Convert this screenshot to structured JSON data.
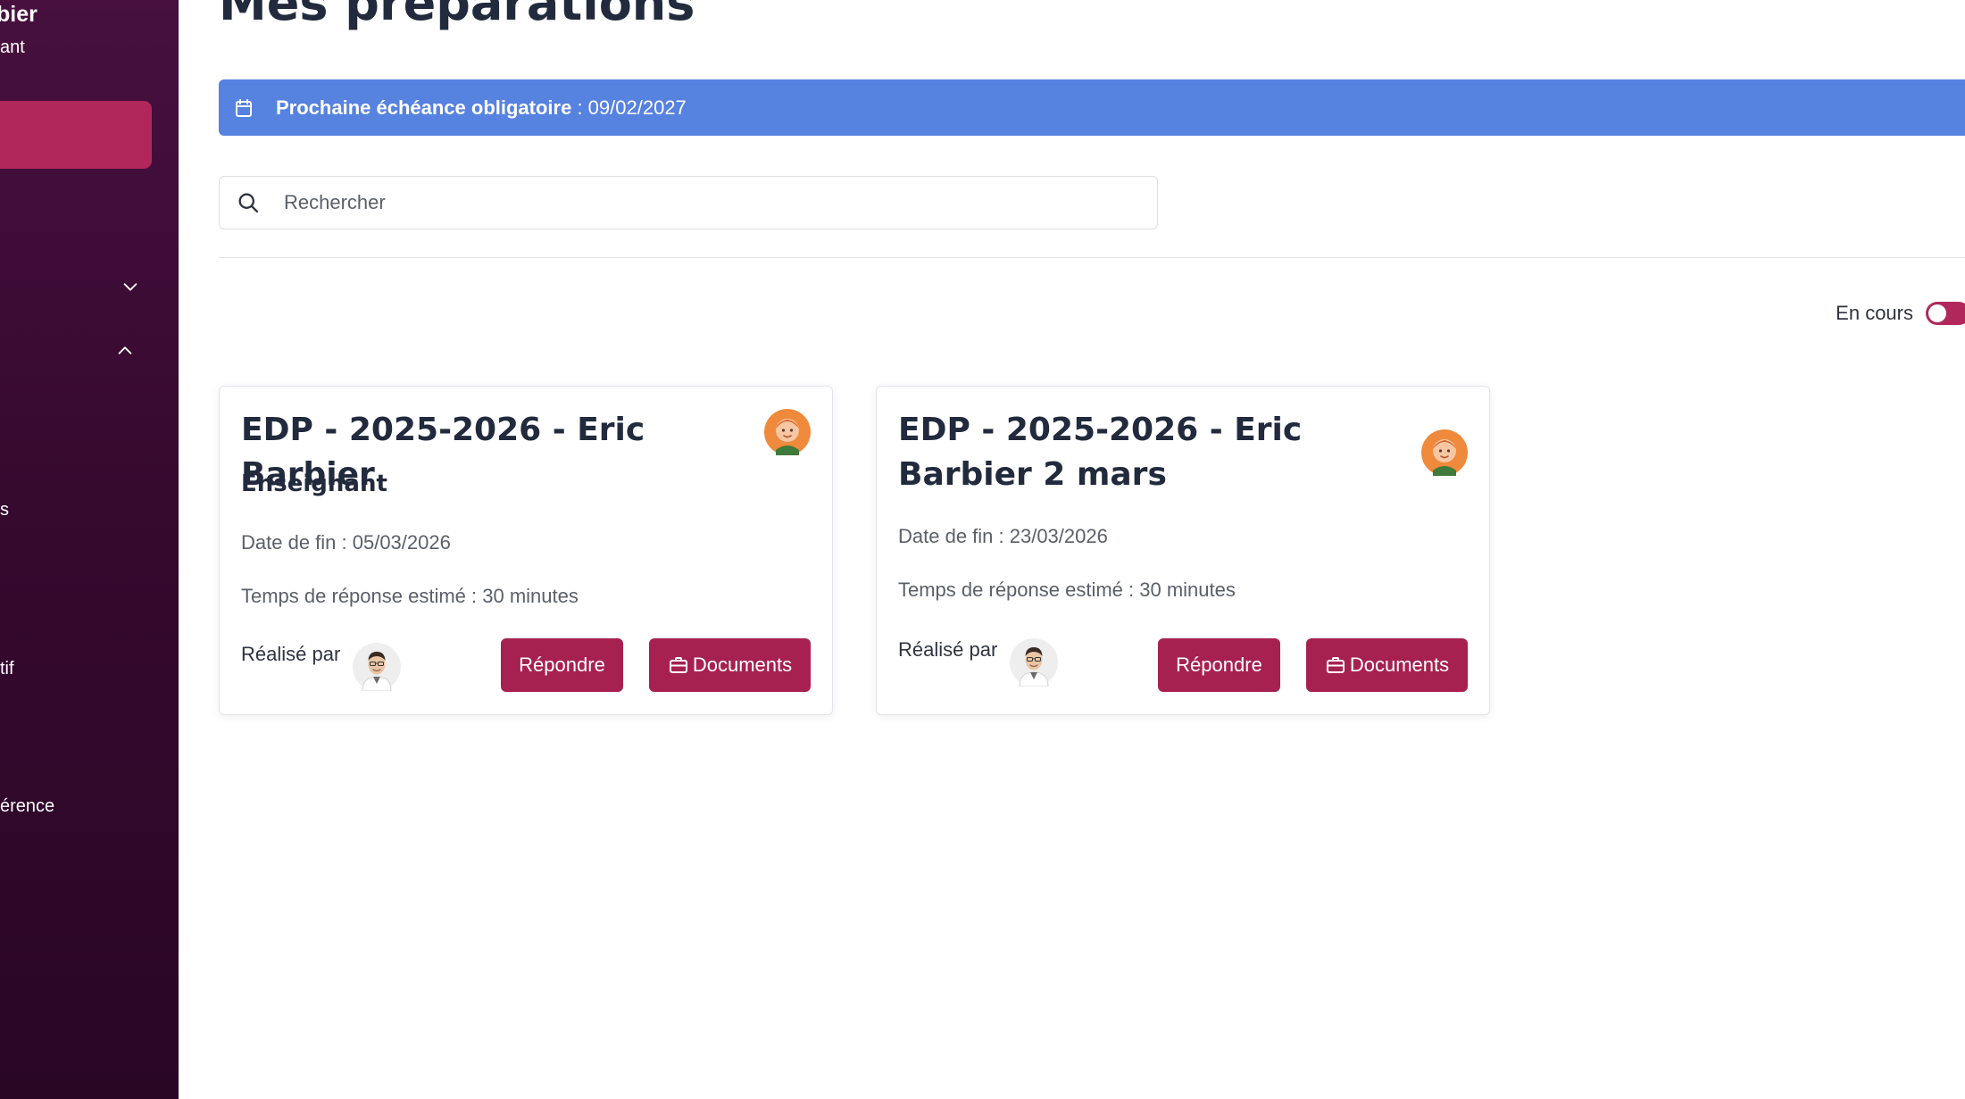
{
  "sidebar": {
    "user_name": "bier",
    "user_role": "ant",
    "items": [
      {
        "label": "s"
      },
      {
        "label": "tif"
      },
      {
        "label": "érence"
      }
    ],
    "icons": [
      "chevron-down-icon",
      "chevron-up-icon"
    ]
  },
  "page": {
    "title": "Mes préparations"
  },
  "banner": {
    "label": "Prochaine échéance obligatoire",
    "value": " : 09/02/2027",
    "icon": "calendar-icon",
    "color": "#5682e0"
  },
  "search": {
    "placeholder": "Rechercher",
    "value": "",
    "icon": "search-icon"
  },
  "filter": {
    "label": "En cours",
    "enabled": true,
    "color": "#b1275c"
  },
  "cards": [
    {
      "title": "EDP - 2025-2026 - Eric Barbier",
      "subtitle": "Enseignant",
      "end_date": "Date de fin : 05/03/2026",
      "estimated_time": "Temps de réponse estimé : 30 minutes",
      "done_by_label": "Réalisé par",
      "respond_label": "Répondre",
      "documents_label": "Documents"
    },
    {
      "title": "EDP - 2025-2026 - Eric Barbier 2 mars",
      "subtitle": "",
      "end_date": "Date de fin : 23/03/2026",
      "estimated_time": "Temps de réponse estimé : 30 minutes",
      "done_by_label": "Réalisé par",
      "respond_label": "Répondre",
      "documents_label": "Documents"
    }
  ],
  "colors": {
    "accent": "#a6214f",
    "sidebar_active": "#b1275c",
    "sidebar_bg": "#3a0a33"
  }
}
